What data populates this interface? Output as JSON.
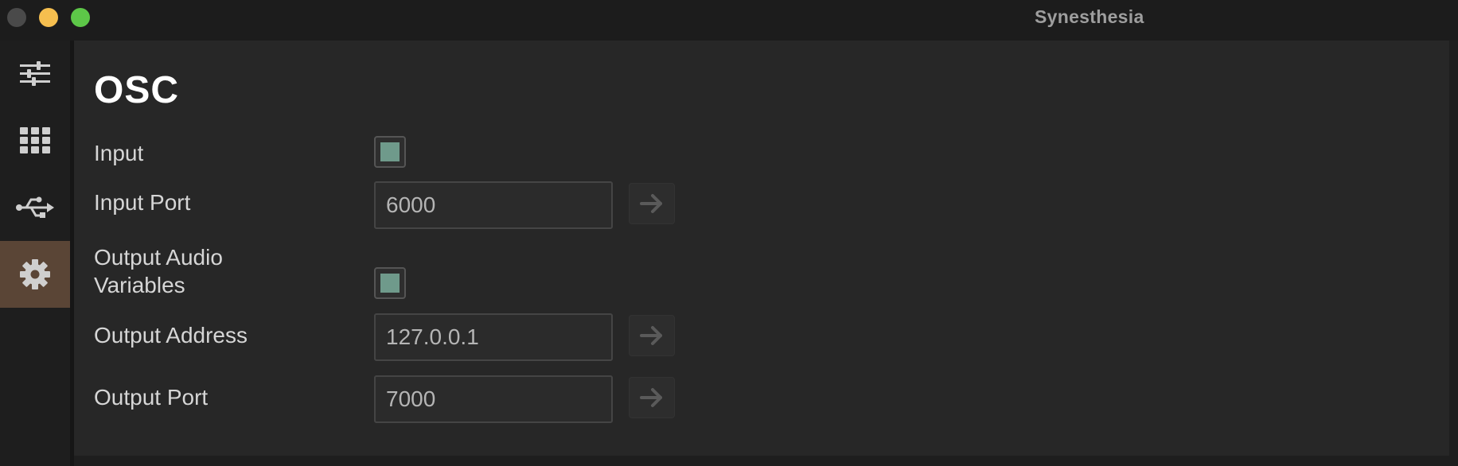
{
  "window": {
    "title": "Synesthesia"
  },
  "sidebar": {
    "items": [
      {
        "name": "mixer",
        "icon": "sliders-icon",
        "active": false
      },
      {
        "name": "grid",
        "icon": "grid-icon",
        "active": false
      },
      {
        "name": "usb",
        "icon": "usb-icon",
        "active": false
      },
      {
        "name": "settings",
        "icon": "gear-icon",
        "active": true
      }
    ],
    "active_color": "#5a4536"
  },
  "osc": {
    "heading": "OSC",
    "input_label": "Input",
    "input_enabled": true,
    "input_port_label": "Input Port",
    "input_port_value": "6000",
    "output_audio_label_line1": "Output Audio",
    "output_audio_label_line2": "Variables",
    "output_audio_enabled": true,
    "output_address_label": "Output Address",
    "output_address_value": "127.0.0.1",
    "output_port_label": "Output Port",
    "output_port_value": "7000"
  },
  "colors": {
    "checkbox_fill": "#6f9a8b",
    "traffic_close": "#4a4a4a",
    "traffic_minimize": "#f6bf4f",
    "traffic_maximize": "#5dc748"
  }
}
